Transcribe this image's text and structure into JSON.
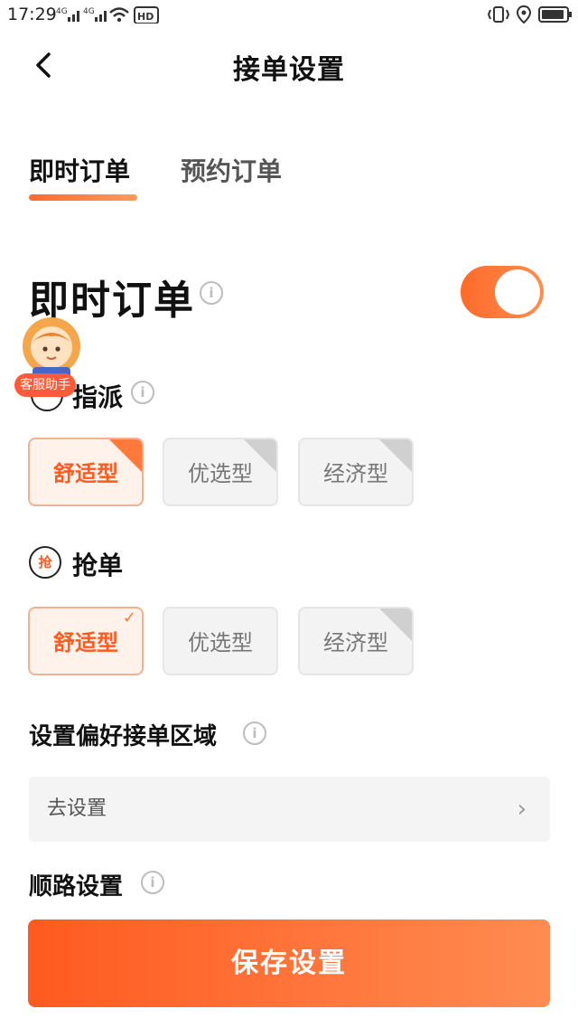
{
  "status_bar": {
    "time": "17:29",
    "net1": "4G",
    "net2": "4G",
    "hd": "HD"
  },
  "header": {
    "title": "接单设置"
  },
  "tabs": [
    {
      "label": "即时订单",
      "active": true
    },
    {
      "label": "预约订单",
      "active": false
    }
  ],
  "section": {
    "title": "即时订单",
    "toggle_on": true
  },
  "assistant": {
    "label": "客服助手"
  },
  "dispatch": {
    "label": "指派",
    "options": [
      {
        "label": "舒适型",
        "selected": true
      },
      {
        "label": "优选型",
        "selected": false
      },
      {
        "label": "经济型",
        "selected": false
      }
    ]
  },
  "grab": {
    "icon_text": "抢",
    "label": "抢单",
    "options": [
      {
        "label": "舒适型",
        "selected": true
      },
      {
        "label": "优选型",
        "selected": false
      },
      {
        "label": "经济型",
        "selected": false
      }
    ]
  },
  "preferred_area": {
    "title": "设置偏好接单区域",
    "placeholder": "去设置"
  },
  "route": {
    "title": "顺路设置"
  },
  "save_button": {
    "label": "保存设置"
  },
  "colors": {
    "accent": "#ff5a1f",
    "accent_light": "#ff8c52"
  }
}
